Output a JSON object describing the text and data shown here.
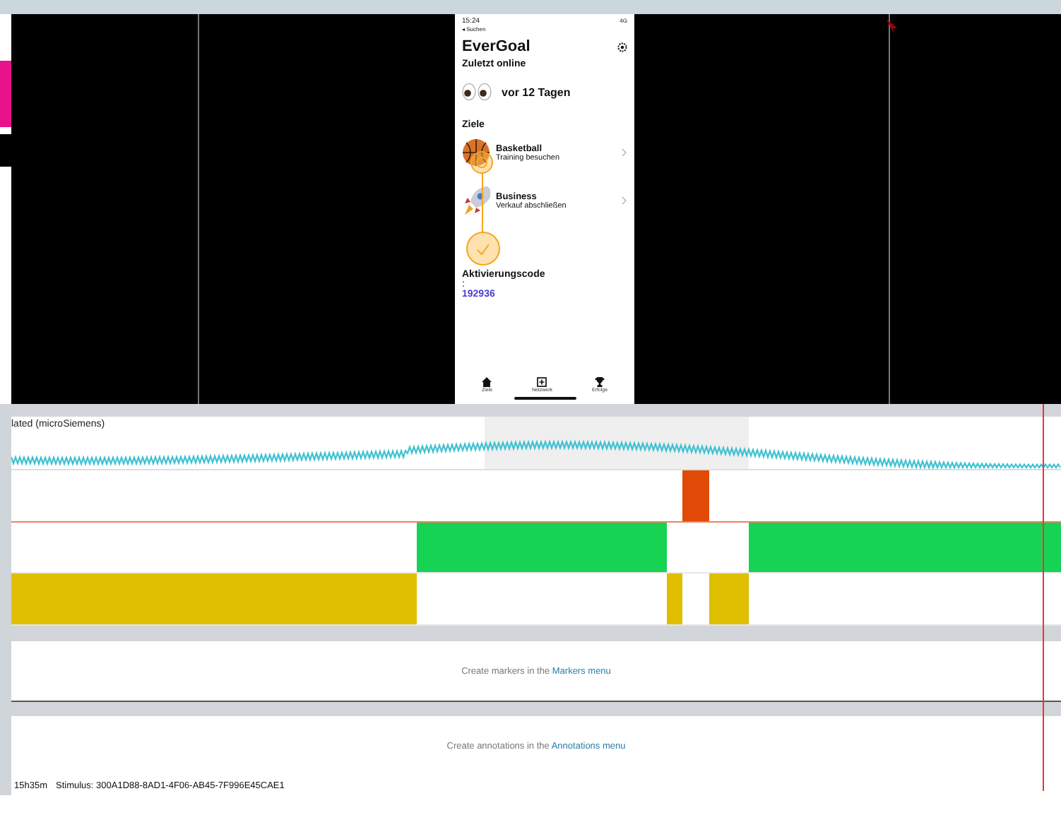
{
  "phone": {
    "status_time": "15:24",
    "back_label": "◂ Suchen",
    "network": "4G",
    "app_title": "EverGoal",
    "last_online_heading": "Zuletzt online",
    "last_online": "vor 12 Tagen",
    "goals_heading": "Ziele",
    "goals": [
      {
        "kind": "basketball",
        "title": "Basketball",
        "subtitle": "Training besuchen"
      },
      {
        "kind": "rocket",
        "title": "Business",
        "subtitle": "Verkauf abschließen"
      }
    ],
    "code_heading": "Aktivierungscode",
    "code_separator": ":",
    "code": "192936",
    "tabs": [
      {
        "kind": "home",
        "label": "Ziele"
      },
      {
        "kind": "plus",
        "label": "Netzwerk"
      },
      {
        "kind": "trophy",
        "label": "Erfolge"
      }
    ]
  },
  "signal_track": {
    "label": "lated (microSiemens)"
  },
  "event_tracks": [
    {
      "kind": "orange",
      "color": "#e04a06"
    },
    {
      "kind": "green",
      "color": "#17d354"
    },
    {
      "kind": "yellow",
      "color": "#dfbf00"
    }
  ],
  "markers_panel": {
    "text": "Create markers in the ",
    "link": "Markers menu"
  },
  "annotations_panel": {
    "text": "Create annotations in the ",
    "link": "Annotations menu"
  },
  "status_bar": {
    "time": "15h35m",
    "stimulus": "Stimulus: 300A1D88-8AD1-4F06-AB45-7F996E45CAE1"
  }
}
